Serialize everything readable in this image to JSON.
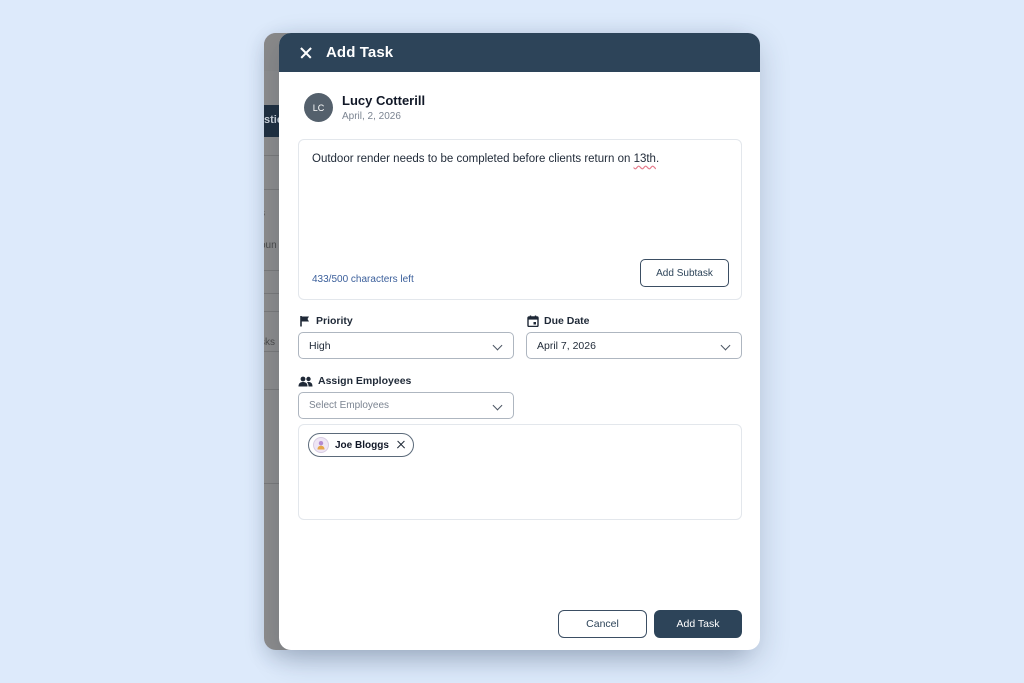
{
  "background_app": {
    "fragments": [
      "stio",
      "s",
      "oun",
      "sks"
    ]
  },
  "modal": {
    "title": "Add Task",
    "close_icon": "close-icon"
  },
  "author": {
    "initials": "LC",
    "name": "Lucy Cotterill",
    "date": "April, 2, 2026"
  },
  "note": {
    "text_before": "Outdoor render needs to be completed before clients return on ",
    "text_spell": "13th",
    "text_after": ".",
    "char_count": "433/500 characters left",
    "add_subtask_label": "Add Subtask"
  },
  "priority": {
    "label": "Priority",
    "icon": "flag-icon",
    "value": "High"
  },
  "due_date": {
    "label": "Due Date",
    "icon": "calendar-icon",
    "value": "April 7, 2026"
  },
  "employees": {
    "label": "Assign Employees",
    "icon": "people-icon",
    "placeholder": "Select Employees",
    "assigned": [
      {
        "name": "Joe Bloggs"
      }
    ]
  },
  "footer": {
    "cancel_label": "Cancel",
    "submit_label": "Add Task"
  },
  "colors": {
    "page_background": "#ddeafb",
    "header": "#2d4459",
    "link": "#3b5f9b"
  }
}
